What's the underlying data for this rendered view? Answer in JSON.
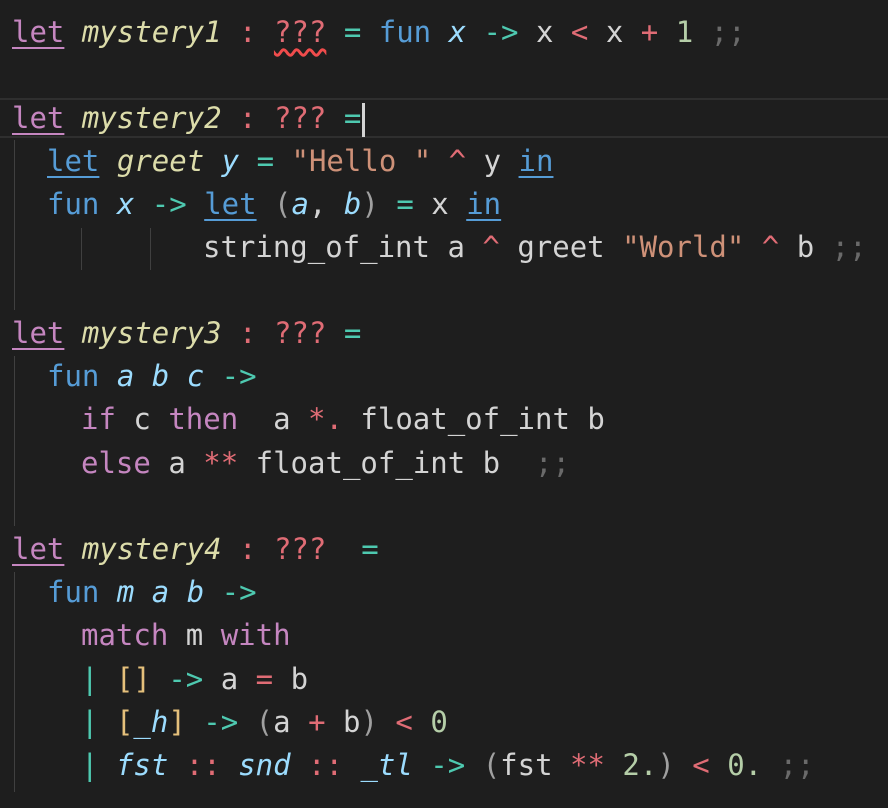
{
  "code": {
    "kw_let": "let",
    "kw_fun": "fun",
    "kw_in": "in",
    "kw_if": "if",
    "kw_then": "then",
    "kw_else": "else",
    "kw_match": "match",
    "kw_with": "with",
    "placeholder": "???",
    "terminator": ";;",
    "mystery1": "mystery1",
    "mystery2": "mystery2",
    "mystery3": "mystery3",
    "mystery4": "mystery4",
    "greet": "greet",
    "str_hello": "\"Hello \"",
    "str_world": "\"World\"",
    "string_of_int": "string_of_int",
    "float_of_int": "float_of_int",
    "num_1": "1",
    "num_0": "0",
    "num_2f": "2.",
    "num_0f": "0."
  },
  "colors": {
    "background": "#1e1e1e",
    "keyword_let": "#c586c0",
    "keyword_fun": "#569cd6",
    "function_name": "#dcdcaa",
    "parameter": "#9cdcfe",
    "operator": "#e06c75",
    "arrow": "#4ec9b0",
    "number": "#b5cea8",
    "string": "#ce9178"
  }
}
